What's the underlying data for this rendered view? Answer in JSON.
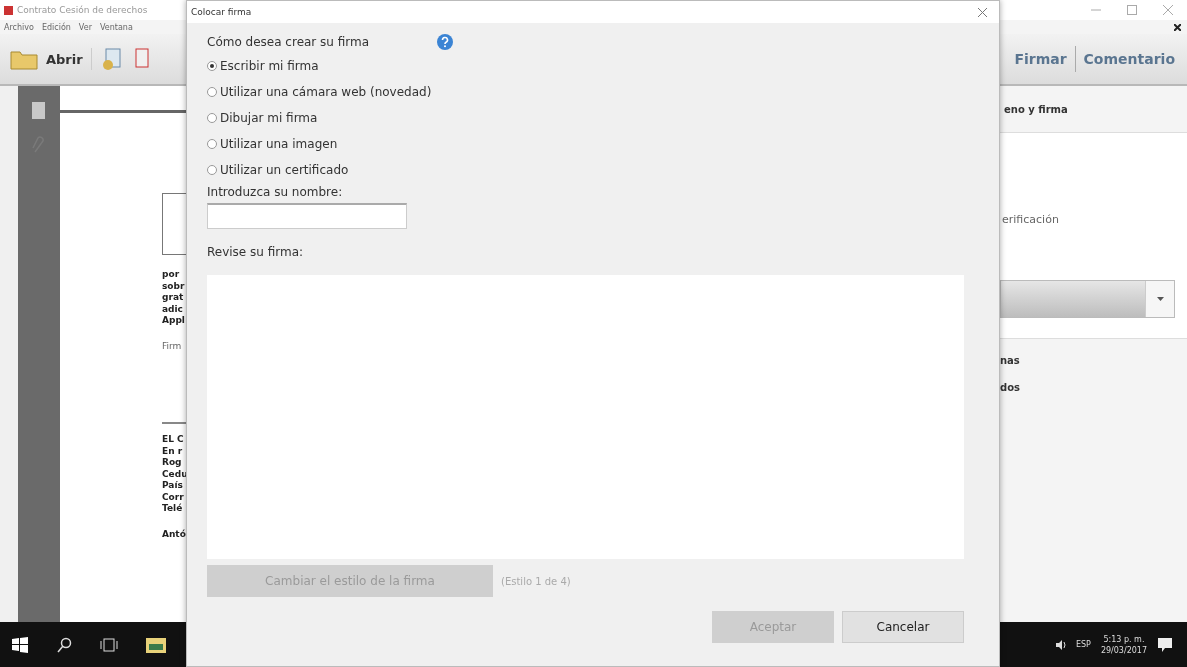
{
  "app": {
    "title": "Contrato Cesión de derechos",
    "menu": [
      "Archivo",
      "Edición",
      "Ver",
      "Ventana"
    ],
    "toolbar": {
      "open_label": "Abrir",
      "tabs": [
        {
          "label": "Firmar",
          "selected": false
        },
        {
          "label": "Comentario",
          "selected": false
        }
      ]
    },
    "document_lines_top": [
      "por",
      "sobr",
      "grat",
      "adic",
      "Appl"
    ],
    "document_signature_label": "Firm",
    "document_lines_bottom": [
      "EL C",
      "En r",
      "Rog",
      "Cedu",
      "País",
      "Corr",
      "Telé"
    ],
    "document_last_line": "Antó",
    "right_pane": {
      "header": "eno y firma",
      "item": "erificación",
      "entries": [
        "nas",
        "dos"
      ]
    }
  },
  "dialog": {
    "title": "Colocar firma",
    "question": "Cómo desea crear su firma",
    "options": [
      {
        "label": "Escribir mi firma",
        "selected": true
      },
      {
        "label": "Utilizar una cámara web (novedad)",
        "selected": false
      },
      {
        "label": "Dibujar mi firma",
        "selected": false
      },
      {
        "label": "Utilizar una imagen",
        "selected": false
      },
      {
        "label": "Utilizar un certificado",
        "selected": false
      }
    ],
    "name_label": "Introduzca su nombre:",
    "preview_label": "Revise su firma:",
    "style_button": {
      "label": "Cambiar el estilo de la firma",
      "disabled": true
    },
    "style_note": "(Estilo 1 de 4)",
    "buttons": [
      {
        "label": "Aceptar",
        "disabled": true
      },
      {
        "label": "Cancelar",
        "disabled": false
      }
    ]
  },
  "taskbar": {
    "language": "ESP",
    "time": "5:13 p. m.",
    "date": "29/03/2017"
  }
}
